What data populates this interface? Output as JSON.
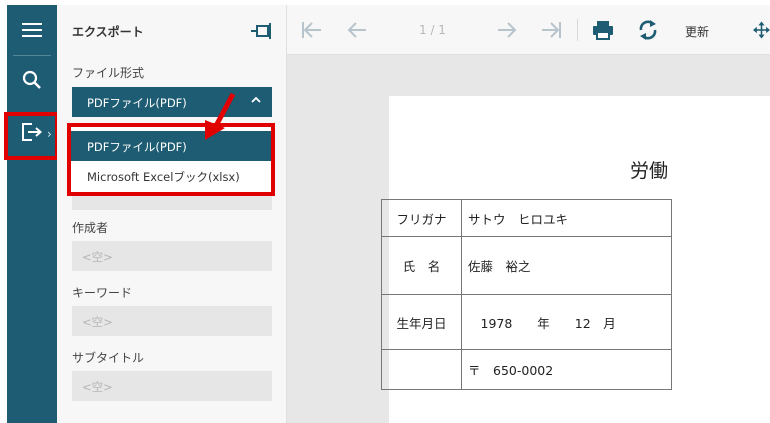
{
  "panel": {
    "title": "エクスポート",
    "format_label": "ファイル形式",
    "format_selected": "PDFファイル(PDF)",
    "format_options": [
      "PDFファイル(PDF)",
      "Microsoft Excelブック(xlsx)"
    ],
    "author_label": "作成者",
    "author_placeholder": "<空>",
    "keyword_label": "キーワード",
    "keyword_placeholder": "<空>",
    "subtitle_label": "サブタイトル",
    "subtitle_placeholder": "<空>"
  },
  "toolbar": {
    "page_indicator": "1 / 1",
    "refresh_label": "更新"
  },
  "document": {
    "title": "労働",
    "rows": [
      {
        "label": "フリガナ",
        "value": "サトウ　ヒロユキ"
      },
      {
        "label": "氏　名",
        "value": "佐藤　裕之"
      },
      {
        "label": "生年月日",
        "value": "　1978　　年　　12　月"
      },
      {
        "label": "",
        "value": "〒　650-0002"
      }
    ]
  },
  "colors": {
    "accent": "#1e5c73",
    "highlight": "#e00000"
  }
}
